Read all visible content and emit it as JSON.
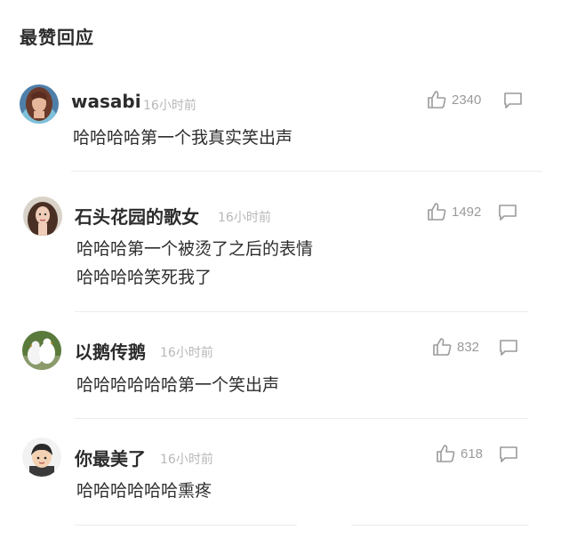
{
  "section": {
    "title": "最赞回应"
  },
  "comments": [
    {
      "name": "wasabi",
      "time": "16小时前",
      "likes": "2340",
      "lines": [
        "哈哈哈哈第一个我真实笑出声"
      ]
    },
    {
      "name": "石头花园的歌女",
      "time": "16小时前",
      "likes": "1492",
      "lines": [
        "哈哈哈第一个被烫了之后的表情",
        "哈哈哈哈笑死我了"
      ]
    },
    {
      "name": "以鹅传鹅",
      "time": "16小时前",
      "likes": "832",
      "lines": [
        "哈哈哈哈哈哈第一个笑出声"
      ]
    },
    {
      "name": "你最美了",
      "time": "16小时前",
      "likes": "618",
      "lines": [
        "哈哈哈哈哈哈熏疼"
      ]
    }
  ],
  "icons": {
    "like": "thumbs-up-icon",
    "reply": "reply-bubble-icon"
  },
  "colors": {
    "name": "#2c2c2c",
    "meta": "#b8b8b8",
    "icon": "#9a9a9a",
    "divider": "#ececec"
  }
}
